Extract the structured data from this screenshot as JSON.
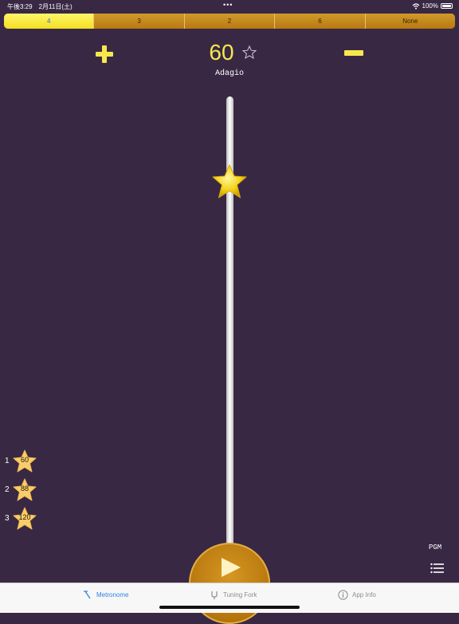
{
  "status": {
    "time": "午後3:29　2月11日(土)",
    "dots": "•••",
    "battery": "100%"
  },
  "beats": {
    "options": [
      "4",
      "3",
      "2",
      "6",
      "None"
    ],
    "selected": "4"
  },
  "tempo": {
    "bpm": "60",
    "marking": "Adagio"
  },
  "presets": [
    {
      "index": "1",
      "bpm": "60"
    },
    {
      "index": "2",
      "bpm": "88"
    },
    {
      "index": "3",
      "bpm": "120"
    }
  ],
  "controls": {
    "pgm_label": "PGM"
  },
  "tabs": [
    {
      "label": "Metronome",
      "icon": "metronome-icon",
      "active": true
    },
    {
      "label": "Tuning Fork",
      "icon": "tuning-fork-icon",
      "active": false
    },
    {
      "label": "App Info",
      "icon": "info-icon",
      "active": false
    }
  ],
  "colors": {
    "background": "#392844",
    "accent": "#f6e84b",
    "segment": "#c48a1d",
    "active_tab": "#2f84e0"
  }
}
